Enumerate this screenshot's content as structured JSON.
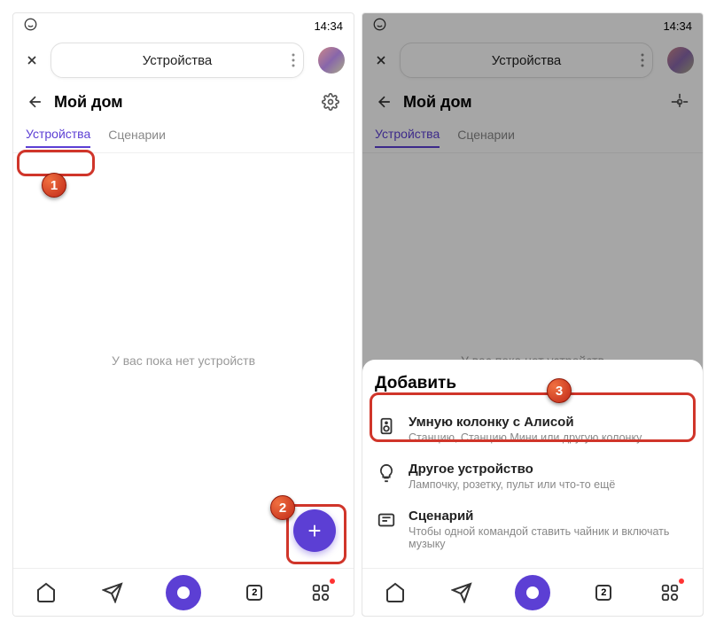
{
  "status": {
    "icon": "whatsapp",
    "time": "14:34"
  },
  "appbar": {
    "title": "Устройства"
  },
  "home": {
    "title": "Мой дом"
  },
  "tabs": {
    "devices": "Устройства",
    "scenarios": "Сценарии"
  },
  "empty": "У вас пока нет устройств",
  "fab": "+",
  "nav": {
    "badge": "2"
  },
  "sheet": {
    "title": "Добавить",
    "items": [
      {
        "title": "Умную колонку с Алисой",
        "sub": "Станцию, Станцию Мини или другую колонку"
      },
      {
        "title": "Другое устройство",
        "sub": "Лампочку, розетку, пульт или что-то ещё"
      },
      {
        "title": "Сценарий",
        "sub": "Чтобы одной командой ставить чайник и включать музыку"
      }
    ]
  },
  "markers": {
    "m1": "1",
    "m2": "2",
    "m3": "3"
  }
}
